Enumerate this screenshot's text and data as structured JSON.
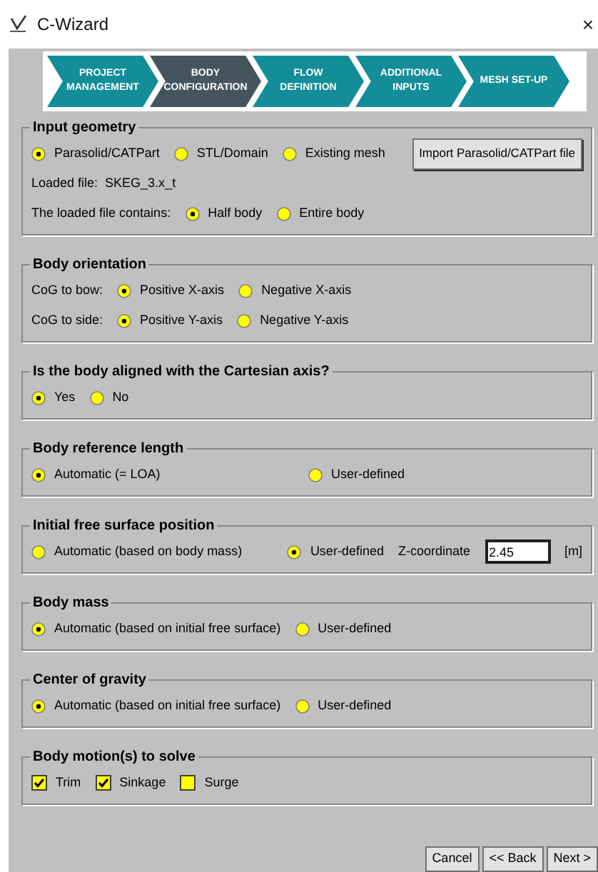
{
  "window": {
    "title": "C-Wizard",
    "close": "×"
  },
  "steps": [
    {
      "label": "PROJECT MANAGEMENT",
      "selected": false
    },
    {
      "label": "BODY CONFIGURATION",
      "selected": true
    },
    {
      "label": "FLOW DEFINITION",
      "selected": false
    },
    {
      "label": "ADDITIONAL INPUTS",
      "selected": false
    },
    {
      "label": "MESH SET-UP",
      "selected": false
    }
  ],
  "groups": [
    {
      "title": "Input geometry",
      "rows": [
        [
          {
            "kind": "radio",
            "label": "Parasolid/CATPart",
            "selected": true
          },
          {
            "kind": "radio",
            "label": "STL/Domain",
            "selected": false
          },
          {
            "kind": "radio",
            "label": "Existing mesh",
            "selected": false
          },
          {
            "kind": "button",
            "label": "Import Parasolid/CATPart file"
          }
        ],
        [
          {
            "kind": "text",
            "text": "Loaded file:  SKEG_3.x_t"
          }
        ],
        [
          {
            "kind": "text",
            "text": "The loaded file contains:"
          },
          {
            "kind": "radio",
            "label": "Half body",
            "selected": true
          },
          {
            "kind": "radio",
            "label": "Entire body",
            "selected": false
          }
        ]
      ]
    },
    {
      "title": "Body orientation",
      "rows": [
        [
          {
            "kind": "text",
            "text": "CoG to bow:"
          },
          {
            "kind": "radio",
            "label": "Positive X-axis",
            "selected": true
          },
          {
            "kind": "radio",
            "label": "Negative X-axis",
            "selected": false
          }
        ],
        [
          {
            "kind": "text",
            "text": "CoG to side:"
          },
          {
            "kind": "radio",
            "label": "Positive Y-axis",
            "selected": true
          },
          {
            "kind": "radio",
            "label": "Negative Y-axis",
            "selected": false
          }
        ]
      ]
    },
    {
      "title": "Is the body aligned with the Cartesian axis?",
      "rows": [
        [
          {
            "kind": "radio",
            "label": "Yes",
            "selected": true
          },
          {
            "kind": "radio",
            "label": "No",
            "selected": false
          }
        ]
      ]
    },
    {
      "title": "Body reference length",
      "rows": [
        [
          {
            "kind": "radio",
            "label": "Automatic (= LOA)",
            "selected": true,
            "wide": true
          },
          {
            "kind": "radio",
            "label": "User-defined",
            "selected": false
          }
        ]
      ]
    },
    {
      "title": "Initial free surface position",
      "rows": [
        [
          {
            "kind": "radio",
            "label": "Automatic (based on body mass)",
            "selected": false,
            "wide": true
          },
          {
            "kind": "radio",
            "label": "User-defined",
            "selected": true
          },
          {
            "kind": "text",
            "text": "Z-coordinate"
          },
          {
            "kind": "input",
            "value": "2.45"
          },
          {
            "kind": "text",
            "text": "[m]"
          }
        ]
      ]
    },
    {
      "title": "Body mass",
      "rows": [
        [
          {
            "kind": "radio",
            "label": "Automatic (based on initial free surface)",
            "selected": true
          },
          {
            "kind": "radio",
            "label": "User-defined",
            "selected": false
          }
        ]
      ]
    },
    {
      "title": "Center of gravity",
      "rows": [
        [
          {
            "kind": "radio",
            "label": "Automatic (based on initial free surface)",
            "selected": true
          },
          {
            "kind": "radio",
            "label": "User-defined",
            "selected": false
          }
        ]
      ]
    },
    {
      "title": "Body motion(s) to solve",
      "rows": [
        [
          {
            "kind": "checkbox",
            "label": "Trim",
            "checked": true
          },
          {
            "kind": "checkbox",
            "label": "Sinkage",
            "checked": true
          },
          {
            "kind": "checkbox",
            "label": "Surge",
            "checked": false
          }
        ]
      ]
    }
  ],
  "buttons": [
    "Cancel",
    "<< Back",
    "Next >"
  ]
}
